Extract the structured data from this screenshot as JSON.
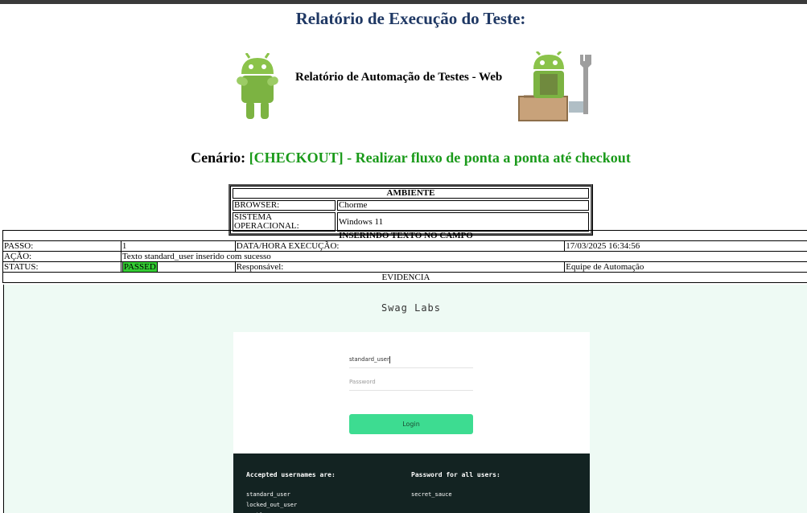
{
  "report": {
    "title": "Relatório de Execução do Teste:",
    "banner_text": "Relatório de Automação de Testes - Web",
    "scenario_label": "Cenário:",
    "scenario_value": "[CHECKOUT] - Realizar fluxo de ponta a ponta até checkout"
  },
  "environment": {
    "header": "AMBIENTE",
    "rows": [
      {
        "key": "BROWSER:",
        "value": "Chorme"
      },
      {
        "key": "SISTEMA OPERACIONAL:",
        "value": "Windows 11"
      }
    ]
  },
  "step": {
    "header": "INSERINDO TEXTO NO CAMPO",
    "passo_label": "PASSO:",
    "passo_value": "1",
    "datetime_label": "DATA/HORA EXECUÇÃO:",
    "datetime_value": "17/03/2025 16:34:56",
    "acao_label": "AÇÃO:",
    "acao_value": "Texto standard_user inserido com sucesso",
    "status_label": "STATUS:",
    "status_value": "PASSED",
    "responsavel_label": "Responsável:",
    "responsavel_value": "Equipe de Automação",
    "evidence_label": "EVIDENCIA"
  },
  "evidence_screen": {
    "app_title": "Swag Labs",
    "username_value": "standard_user",
    "password_placeholder": "Password",
    "login_label": "Login",
    "usernames_heading": "Accepted usernames are:",
    "usernames": [
      "standard_user",
      "locked_out_user",
      "problem_user"
    ],
    "password_heading": "Password for all users:",
    "password_value": "secret_sauce"
  },
  "colors": {
    "title": "#1f3864",
    "scenario_value": "#1a9a1a",
    "passed": "#33cc33",
    "login_button": "#3ddc91",
    "creds_bg": "#132322",
    "evidence_bg": "#eefaf4"
  }
}
